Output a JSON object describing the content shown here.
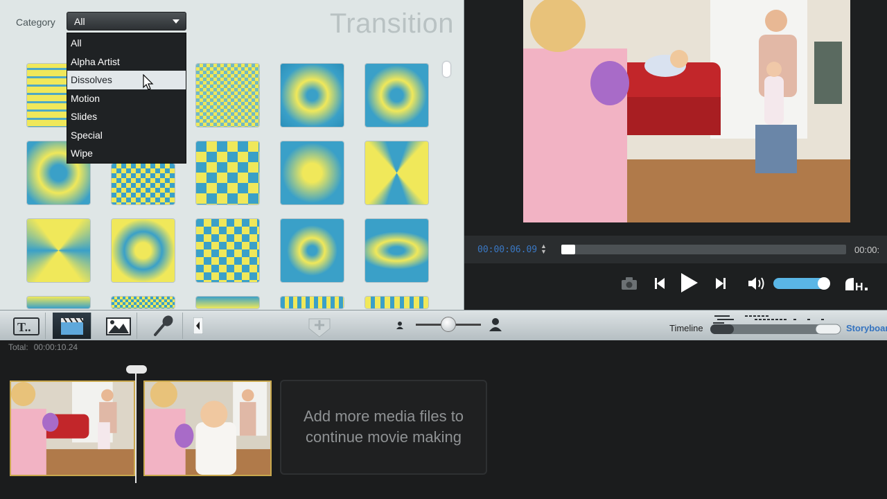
{
  "transition_panel": {
    "category_label": "Category",
    "selected_category": "All",
    "title": "Transition",
    "dropdown_options": [
      "All",
      "Alpha Artist",
      "Dissolves",
      "Motion",
      "Slides",
      "Special",
      "Wipe"
    ],
    "highlighted_option": "Dissolves"
  },
  "preview": {
    "current_time": "00:00:06.09",
    "end_time": "00:00:",
    "playback_progress": 0.0,
    "volume_level": 0.85
  },
  "toolbar": {
    "timeline_label": "Timeline",
    "storyboard_label": "Storyboard",
    "zoom_level": 0.5
  },
  "timeline": {
    "total_label": "Total:",
    "total_time": "00:00:10.24",
    "add_media_text_line1": "Add more media files to",
    "add_media_text_line2": "continue movie making"
  },
  "colors": {
    "accent_blue": "#3a78c4",
    "clip_border": "#c9a84d",
    "transition_blue": "#3aa0c8",
    "transition_yellow": "#f0e85a"
  }
}
